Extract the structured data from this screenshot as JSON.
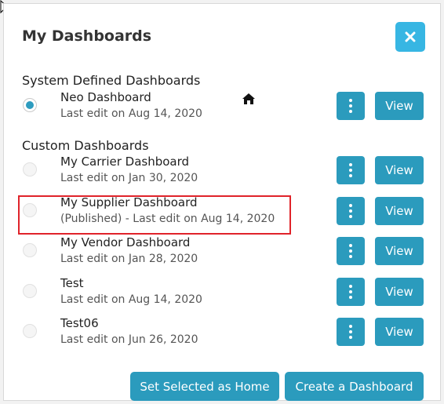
{
  "dialog": {
    "title": "My Dashboards"
  },
  "sections": {
    "system": "System Defined Dashboards",
    "custom": "Custom Dashboards"
  },
  "dashboards": [
    {
      "name": "Neo Dashboard",
      "meta": "Last edit on Aug 14, 2020",
      "selected": true,
      "home": true
    },
    {
      "name": "My Carrier Dashboard",
      "meta": "Last edit on Jan 30, 2020",
      "selected": false
    },
    {
      "name": "My Supplier Dashboard",
      "meta": "(Published) - Last edit on Aug 14, 2020",
      "selected": false,
      "highlighted": true
    },
    {
      "name": "My Vendor Dashboard",
      "meta": "Last edit on Jan 28, 2020",
      "selected": false
    },
    {
      "name": "Test",
      "meta": "Last edit on Aug 14, 2020",
      "selected": false
    },
    {
      "name": "Test06",
      "meta": "Last edit on Jun 26, 2020",
      "selected": false
    }
  ],
  "buttons": {
    "view": "View",
    "set_home": "Set Selected as Home",
    "create": "Create a Dashboard"
  },
  "colors": {
    "accent": "#2b9bbd",
    "close": "#37b6e3",
    "highlight": "#e0232a"
  },
  "icons": {
    "close": "close-icon",
    "home": "home-icon",
    "more": "more-vertical-icon"
  }
}
